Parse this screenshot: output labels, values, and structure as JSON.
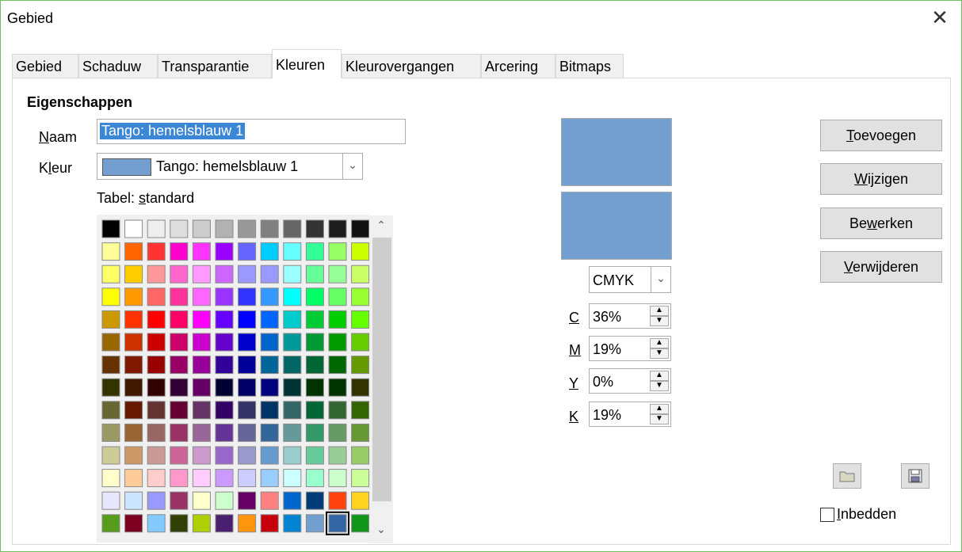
{
  "window": {
    "title": "Gebied",
    "close_label": "✕"
  },
  "tabs": [
    {
      "label": "Gebied"
    },
    {
      "label": "Schaduw"
    },
    {
      "label": "Transparantie"
    },
    {
      "label": "Kleuren"
    },
    {
      "label": "Kleurovergangen"
    },
    {
      "label": "Arcering"
    },
    {
      "label": "Bitmaps"
    }
  ],
  "properties": {
    "heading": "Eigenschappen",
    "name_label": "Naam",
    "name_value": "Tango: hemelsblauw 1",
    "color_label": "Kleur",
    "color_value": "Tango: hemelsblauw 1",
    "color_swatch": "#729fcf",
    "table_label": "Tabel: standard"
  },
  "palette": {
    "selected_row": 13,
    "selected_col": 10,
    "rows": [
      [
        "#000000",
        "#ffffff",
        "#eeeeee",
        "#dddddd",
        "#cccccc",
        "#b2b2b2",
        "#999999",
        "#808080",
        "#666666",
        "#333333",
        "#1c1c1c",
        "#111111"
      ],
      [
        "#ffff99",
        "#ff6600",
        "#ff3333",
        "#ff00cc",
        "#ff33ff",
        "#9900ff",
        "#6666ff",
        "#00ccff",
        "#66ffff",
        "#33ff99",
        "#99ff66",
        "#ccff00"
      ],
      [
        "#ffff66",
        "#ffcc00",
        "#ff9999",
        "#ff66cc",
        "#ff99ff",
        "#cc66ff",
        "#9999ff",
        "#9999ff",
        "#99ffff",
        "#66ff99",
        "#99ff99",
        "#ccff66"
      ],
      [
        "#ffff00",
        "#ff9900",
        "#ff6666",
        "#ff3399",
        "#ff66ff",
        "#9933ff",
        "#3333ff",
        "#3399ff",
        "#00ffff",
        "#00ff66",
        "#66ff66",
        "#99ff33"
      ],
      [
        "#cc9900",
        "#ff3300",
        "#ff0000",
        "#ff0066",
        "#ff00ff",
        "#6600ff",
        "#0000ff",
        "#0066ff",
        "#00cccc",
        "#00cc33",
        "#00cc00",
        "#66ff00"
      ],
      [
        "#996600",
        "#cc3300",
        "#cc0000",
        "#cc0066",
        "#cc00cc",
        "#6600cc",
        "#0000cc",
        "#0066cc",
        "#009999",
        "#009933",
        "#009900",
        "#66cc00"
      ],
      [
        "#663300",
        "#801900",
        "#990000",
        "#990066",
        "#990099",
        "#330099",
        "#000099",
        "#006699",
        "#006666",
        "#006633",
        "#006600",
        "#669900"
      ],
      [
        "#333300",
        "#401900",
        "#330000",
        "#330033",
        "#660066",
        "#000033",
        "#000066",
        "#000080",
        "#003333",
        "#003300",
        "#003300",
        "#333300"
      ],
      [
        "#666633",
        "#661900",
        "#663333",
        "#660033",
        "#663366",
        "#330066",
        "#333366",
        "#003366",
        "#336666",
        "#006633",
        "#336633",
        "#336600"
      ],
      [
        "#999966",
        "#996633",
        "#996666",
        "#993366",
        "#996699",
        "#663399",
        "#666699",
        "#336699",
        "#669999",
        "#339966",
        "#669966",
        "#669933"
      ],
      [
        "#cccc99",
        "#cc9966",
        "#cc9999",
        "#cc6699",
        "#cc99cc",
        "#9966cc",
        "#9999cc",
        "#6699cc",
        "#99cccc",
        "#66cc99",
        "#99cc99",
        "#99cc66"
      ],
      [
        "#ffffcc",
        "#ffcc99",
        "#ffcccc",
        "#ff99cc",
        "#ffccff",
        "#cc99ff",
        "#ccccff",
        "#99ccff",
        "#ccffff",
        "#99ffcc",
        "#ccffcc",
        "#ccff99"
      ],
      [
        "#e6e6ff",
        "#cce5ff",
        "#9999ff",
        "#993366",
        "#ffffcc",
        "#ccffcc",
        "#660066",
        "#ff8080",
        "#0066cc",
        "#003c78",
        "#ff420e",
        "#ffd320"
      ],
      [
        "#579d1c",
        "#7e0021",
        "#83caff",
        "#314004",
        "#aecf00",
        "#4b1f6f",
        "#ff950e",
        "#c5000b",
        "#0084d1",
        "#729fcf",
        "#3465a4",
        "#109618"
      ]
    ]
  },
  "color_model": {
    "mode": "CMYK",
    "fields": [
      {
        "label": "C",
        "value": "36%"
      },
      {
        "label": "M",
        "value": "19%"
      },
      {
        "label": "Y",
        "value": "0%"
      },
      {
        "label": "K",
        "value": "19%"
      }
    ]
  },
  "preview": {
    "old_color": "#729fcf",
    "new_color": "#729fcf"
  },
  "buttons": {
    "add": "Toevoegen",
    "modify": "Wijzigen",
    "edit": "Bewerken",
    "delete": "Verwijderen"
  },
  "embed": {
    "label": "Inbedden",
    "checked": false
  }
}
